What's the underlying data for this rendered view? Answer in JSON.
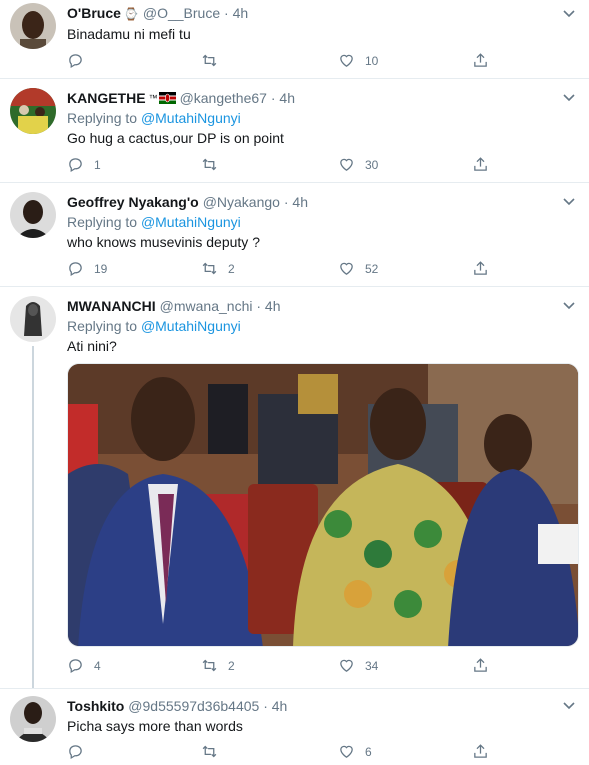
{
  "tweets": [
    {
      "name": "O'Bruce",
      "badge": "⌚",
      "handle": "@O__Bruce",
      "time": "4h",
      "replying_label": "",
      "replying_to": "",
      "text": "Binadamu ni mefi tu",
      "replies": "",
      "retweets": "",
      "likes": "10"
    },
    {
      "name": "KANGETHE",
      "badge": "™",
      "handle": "@kangethe67",
      "time": "4h",
      "replying_label": "Replying to",
      "replying_to": "@MutahiNgunyi",
      "text": "Go hug a cactus,our DP is on point",
      "replies": "1",
      "retweets": "",
      "likes": "30"
    },
    {
      "name": "Geoffrey Nyakang'o",
      "badge": "",
      "handle": "@Nyakango",
      "time": "4h",
      "replying_label": "Replying to",
      "replying_to": "@MutahiNgunyi",
      "text": "who knows musevinis deputy ?",
      "replies": "19",
      "retweets": "2",
      "likes": "52"
    },
    {
      "name": "MWANANCHI",
      "badge": "",
      "handle": "@mwana_nchi",
      "time": "4h",
      "replying_label": "Replying to",
      "replying_to": "@MutahiNgunyi",
      "text": "Ati nini?",
      "replies": "4",
      "retweets": "2",
      "likes": "34"
    },
    {
      "name": "Toshkito",
      "badge": "",
      "handle": "@9d55597d36b4405",
      "time": "4h",
      "replying_label": "",
      "replying_to": "",
      "text": "Picha says more than words",
      "replies": "",
      "retweets": "",
      "likes": "6"
    }
  ],
  "dot": "·",
  "colors": {
    "link": "#1b95e0",
    "secondary": "#657786",
    "border": "#e6ecf0"
  }
}
